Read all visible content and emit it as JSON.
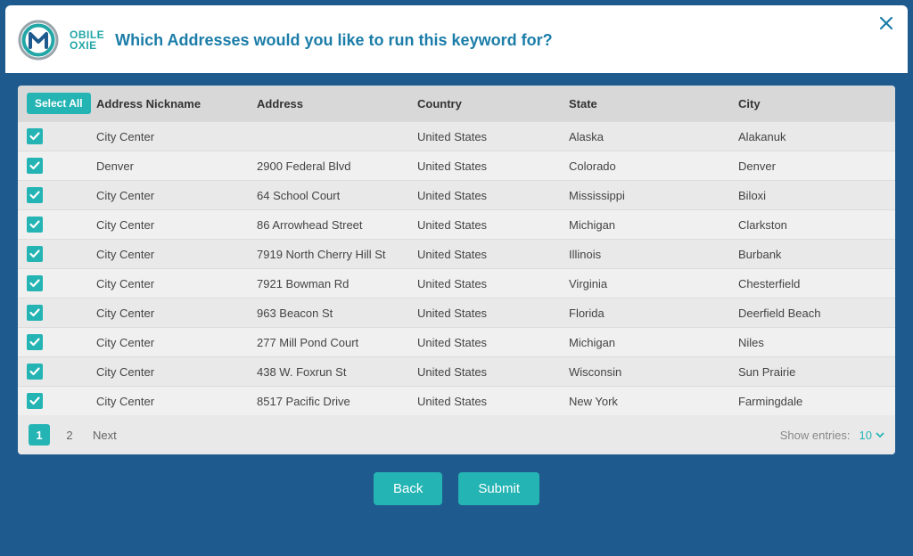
{
  "brand": {
    "top": "OBILE",
    "bot": "OXIE"
  },
  "title": "Which Addresses would you like to run this keyword for?",
  "selectAllLabel": "Select All",
  "columns": {
    "nickname": "Address Nickname",
    "address": "Address",
    "country": "Country",
    "state": "State",
    "city": "City"
  },
  "rows": [
    {
      "nickname": "City Center",
      "address": "",
      "country": "United States",
      "state": "Alaska",
      "city": "Alakanuk"
    },
    {
      "nickname": "Denver",
      "address": "2900 Federal Blvd",
      "country": "United States",
      "state": "Colorado",
      "city": "Denver"
    },
    {
      "nickname": "City Center",
      "address": "64 School Court",
      "country": "United States",
      "state": "Mississippi",
      "city": "Biloxi"
    },
    {
      "nickname": "City Center",
      "address": "86 Arrowhead Street",
      "country": "United States",
      "state": "Michigan",
      "city": "Clarkston"
    },
    {
      "nickname": "City Center",
      "address": "7919 North Cherry Hill St",
      "country": "United States",
      "state": "Illinois",
      "city": "Burbank"
    },
    {
      "nickname": "City Center",
      "address": "7921 Bowman Rd",
      "country": "United States",
      "state": "Virginia",
      "city": "Chesterfield"
    },
    {
      "nickname": "City Center",
      "address": "963 Beacon St",
      "country": "United States",
      "state": "Florida",
      "city": "Deerfield Beach"
    },
    {
      "nickname": "City Center",
      "address": "277 Mill Pond Court",
      "country": "United States",
      "state": "Michigan",
      "city": "Niles"
    },
    {
      "nickname": "City Center",
      "address": "438 W. Foxrun St",
      "country": "United States",
      "state": "Wisconsin",
      "city": "Sun Prairie"
    },
    {
      "nickname": "City Center",
      "address": "8517 Pacific Drive",
      "country": "United States",
      "state": "New York",
      "city": "Farmingdale"
    }
  ],
  "pagination": {
    "pages": [
      "1",
      "2"
    ],
    "activeIndex": 0,
    "next": "Next",
    "showEntriesLabel": "Show entries:",
    "showEntriesValue": "10"
  },
  "actions": {
    "back": "Back",
    "submit": "Submit"
  }
}
